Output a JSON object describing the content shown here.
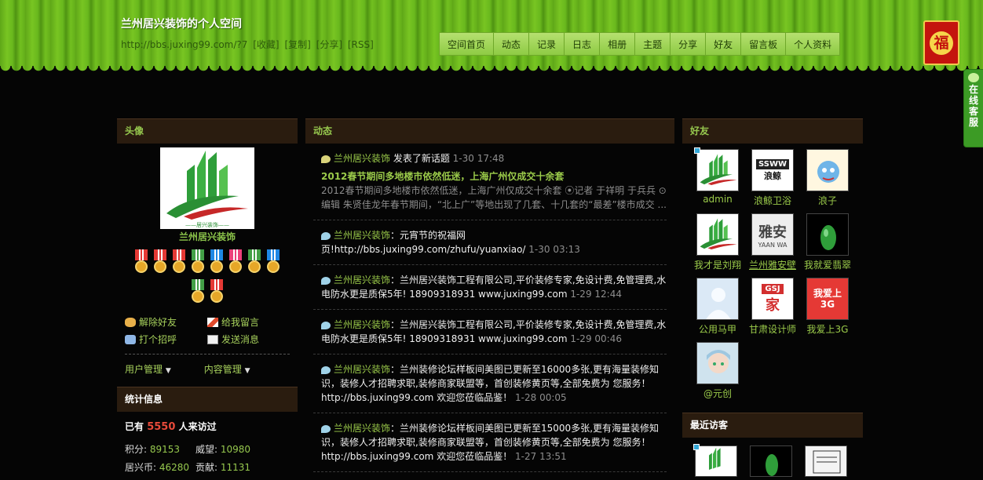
{
  "header": {
    "title": "兰州居兴装饰的个人空间",
    "url": "http://bbs.juxing99.com/?7",
    "links": [
      "[收藏]",
      "[复制]",
      "[分享]",
      "[RSS]"
    ],
    "nav": [
      "空间首页",
      "动态",
      "记录",
      "日志",
      "相册",
      "主题",
      "分享",
      "好友",
      "留言板",
      "个人资料"
    ],
    "fu_char": "福"
  },
  "service": {
    "text": "在线客服",
    "icon": "chat-bubble-icon"
  },
  "left": {
    "avatar_title": "头像",
    "logo_caption": "——居兴装饰——",
    "username": "兰州居兴装饰",
    "medal_colors": [
      "#e53935",
      "#e53935",
      "#e53935",
      "#43a047",
      "#1e88e5",
      "#ec407a",
      "#43a047",
      "#1e88e5",
      "#43a047",
      "#e53935"
    ],
    "actions": [
      {
        "label": "解除好友",
        "icon": "handshake-icon"
      },
      {
        "label": "给我留言",
        "icon": "pencil-icon"
      },
      {
        "label": "打个招呼",
        "icon": "greet-icon"
      },
      {
        "label": "发送消息",
        "icon": "envelope-icon"
      }
    ],
    "user_manage": "用户管理",
    "content_manage": "内容管理",
    "stats_title": "统计信息",
    "visitors_prefix": "已有",
    "visitors_count": "5550",
    "visitors_suffix": "人来访过",
    "stats": [
      {
        "label": "积分:",
        "value": "89153"
      },
      {
        "label": "威望:",
        "value": "10980"
      },
      {
        "label": "居兴币:",
        "value": "46280"
      },
      {
        "label": "贡献:",
        "value": "11131"
      }
    ]
  },
  "feed": {
    "title": "动态",
    "items": [
      {
        "user": "兰州居兴装饰",
        "text": " 发表了新话题 ",
        "time": "1-30 17:48",
        "link": "2012春节期间多地楼市依然低迷，上海广州仅成交十余套",
        "excerpt": "2012春节期间多地楼市依然低迷，上海广州仅成交十余套 ⦿记者 于祥明 于兵兵 ⊙编辑 朱贤佳龙年春节期间，“北上广”等地出现了几套、十几套的“最差”楼市成交 ..."
      },
      {
        "user": "兰州居兴装饰",
        "text": "：元宵节的祝福网页!http://bbs.juxing99.com/zhufu/yuanxiao/ ",
        "time": "1-30 03:13"
      },
      {
        "user": "兰州居兴装饰",
        "text": "：兰州居兴装饰工程有限公司,平价装修专家,免设计费,免管理费,水电防水更是质保5年! 18909318931 www.juxing99.com ",
        "time": "1-29 12:44"
      },
      {
        "user": "兰州居兴装饰",
        "text": "：兰州居兴装饰工程有限公司,平价装修专家,免设计费,免管理费,水电防水更是质保5年! 18909318931 www.juxing99.com ",
        "time": "1-29 00:46"
      },
      {
        "user": "兰州居兴装饰",
        "text": "：兰州装修论坛样板间美图已更新至16000多张,更有海量装修知识，装修人才招聘求职,装修商家联盟等，首创装修黄页等,全部免费为 您服务！ http://bbs.juxing99.com 欢迎您莅临品鉴！ ",
        "time": "1-28 00:05"
      },
      {
        "user": "兰州居兴装饰",
        "text": "：兰州装修论坛样板间美图已更新至15000多张,更有海量装修知识，装修人才招聘求职,装修商家联盟等，首创装修黄页等,全部免费为 您服务！ http://bbs.juxing99.com 欢迎您莅临品鉴！ ",
        "time": "1-27 13:51"
      }
    ]
  },
  "friends": {
    "title": "好友",
    "list": [
      {
        "name": "admin",
        "kind": "logo",
        "online": true
      },
      {
        "name": "浪鲸卫浴",
        "kind": "ssww"
      },
      {
        "name": "浪子",
        "kind": "cartoon"
      },
      {
        "name": "我才是刘翔",
        "kind": "logo"
      },
      {
        "name": "兰州雅安壁",
        "kind": "yaan"
      },
      {
        "name": "我就爱翡翠",
        "kind": "jade"
      },
      {
        "name": "公用马甲",
        "kind": "default"
      },
      {
        "name": "甘肃设计师",
        "kind": "gsj"
      },
      {
        "name": "我爱上3G",
        "kind": "love3g"
      },
      {
        "name": "@元创",
        "kind": "anime"
      }
    ],
    "love3g_text": "我爱上3G",
    "ssww_text": "SSWW",
    "ssww_cn": "浪鲸",
    "yaan_text": "雅安",
    "yaan_en": "YAAN WA",
    "gsj_text": "GSJ",
    "gsj_cn": "家"
  },
  "recent": {
    "title": "最近访客"
  }
}
